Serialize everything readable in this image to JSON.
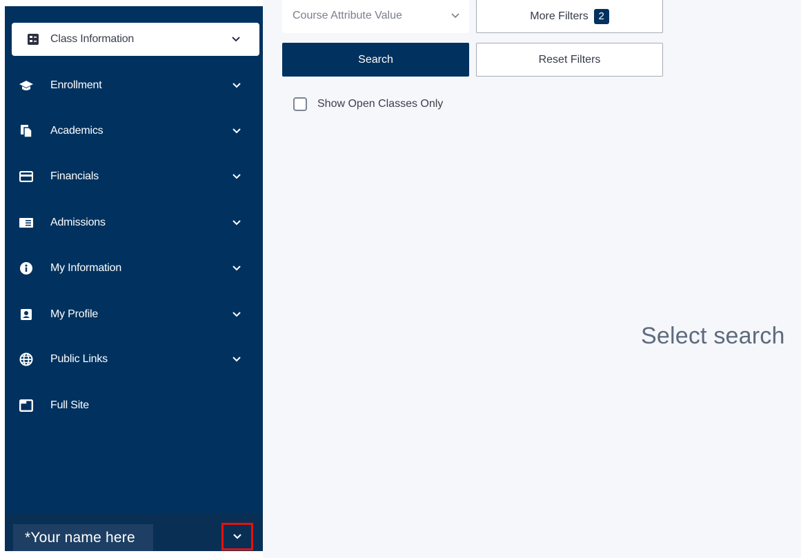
{
  "sidebar": {
    "items": [
      {
        "label": "Class Information",
        "icon": "class-info-icon",
        "active": true
      },
      {
        "label": "Enrollment",
        "icon": "graduation-cap-icon"
      },
      {
        "label": "Academics",
        "icon": "documents-icon"
      },
      {
        "label": "Financials",
        "icon": "credit-card-icon"
      },
      {
        "label": "Admissions",
        "icon": "admissions-icon"
      },
      {
        "label": "My Information",
        "icon": "info-icon"
      },
      {
        "label": "My Profile",
        "icon": "profile-icon"
      },
      {
        "label": "Public Links",
        "icon": "globe-icon"
      },
      {
        "label": "Full Site",
        "icon": "window-icon"
      }
    ],
    "user_name": "*Your name here"
  },
  "filters": {
    "course_attribute_placeholder": "Course Attribute Value",
    "more_filters_label": "More Filters",
    "more_filters_count": "2",
    "search_label": "Search",
    "reset_label": "Reset Filters",
    "open_only_label": "Show Open Classes Only"
  },
  "results": {
    "message": "Select search"
  },
  "colors": {
    "sidebar_bg": "#01325f",
    "accent": "#01325f",
    "highlight_border": "#e8100b"
  }
}
